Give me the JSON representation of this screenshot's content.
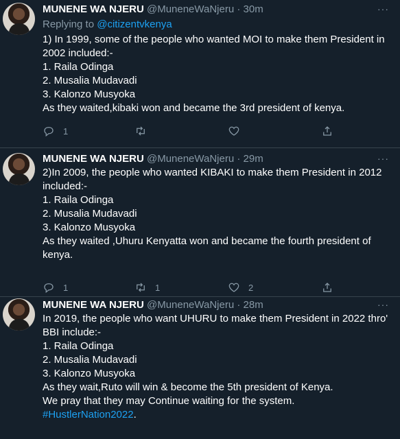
{
  "tweets": [
    {
      "name": "MUNENE WA NJERU",
      "handle": "@MuneneWaNjeru",
      "separator": "·",
      "time": "30m",
      "more": "···",
      "reply_prefix": "Replying to",
      "reply_to": "@citizentvkenya",
      "lines": [
        "1) In 1999, some of the people who wanted MOI to make them President in",
        "2002 included:-",
        "1. Raila Odinga",
        "2. Musalia Mudavadi",
        "3. Kalonzo Musyoka",
        "As they waited,kibaki won and became the 3rd president of kenya."
      ],
      "actions": {
        "reply_count": "1",
        "retweet_count": "",
        "like_count": ""
      }
    },
    {
      "name": "MUNENE WA NJERU",
      "handle": "@MuneneWaNjeru",
      "separator": "·",
      "time": "29m",
      "more": "···",
      "lines": [
        "2)In 2009, the people who wanted KIBAKI to make them President in 2012",
        "included:-",
        "1. Raila Odinga",
        "2. Musalia Mudavadi",
        "3. Kalonzo Musyoka",
        "As they waited ,Uhuru Kenyatta won and became the fourth president of",
        "kenya."
      ],
      "actions": {
        "reply_count": "1",
        "retweet_count": "1",
        "like_count": "2"
      }
    },
    {
      "name": "MUNENE WA NJERU",
      "handle": "@MuneneWaNjeru",
      "separator": "·",
      "time": "28m",
      "more": "···",
      "lines": [
        "In 2019, the people who want UHURU to make them President in 2022 thro'",
        "BBI include:-",
        "1. Raila Odinga",
        "2. Musalia Mudavadi",
        "3. Kalonzo Musyoka",
        "As they wait,Ruto will win & become the 5th president of Kenya.",
        "We pray that they may Continue waiting for the system."
      ],
      "hashtag": "#HustlerNation2022",
      "hashtag_suffix": "."
    }
  ],
  "colors": {
    "background": "#15202b",
    "text": "#ffffff",
    "muted": "#8899a6",
    "link": "#1da1f2",
    "divider": "#38444d"
  }
}
